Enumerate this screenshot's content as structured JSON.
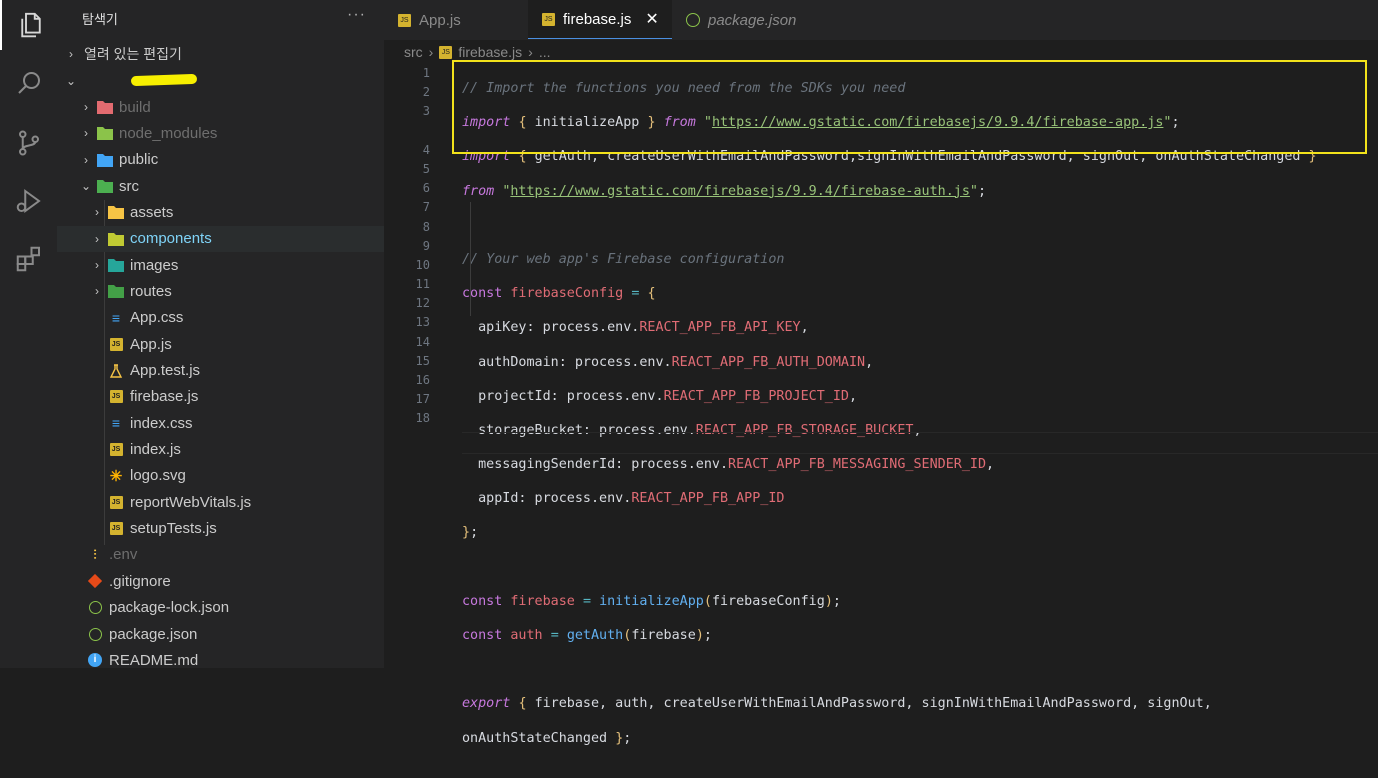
{
  "sidebar": {
    "title": "탐색기",
    "more": "···",
    "open_editors": "열려 있는 편집기",
    "items": [
      {
        "label": "build",
        "kind": "folder",
        "color": "#e36b70",
        "dim": true,
        "chev": "›"
      },
      {
        "label": "node_modules",
        "kind": "folder",
        "color": "#8bc34a",
        "dim": true,
        "chev": "›"
      },
      {
        "label": "public",
        "kind": "folder",
        "color": "#42a5f5",
        "dim": false,
        "chev": "›"
      },
      {
        "label": "src",
        "kind": "folder",
        "color": "#4caf50",
        "dim": false,
        "chev": "⌄"
      },
      {
        "label": "assets",
        "kind": "folder",
        "color": "#f6c445",
        "dim": false,
        "chev": "›"
      },
      {
        "label": "components",
        "kind": "folder",
        "color": "#c0ca33",
        "dim": false,
        "chev": "›"
      },
      {
        "label": "images",
        "kind": "folder",
        "color": "#26a69a",
        "dim": false,
        "chev": "›"
      },
      {
        "label": "routes",
        "kind": "folder",
        "color": "#43a047",
        "dim": false,
        "chev": "›"
      },
      {
        "label": "App.css",
        "kind": "css"
      },
      {
        "label": "App.js",
        "kind": "js"
      },
      {
        "label": "App.test.js",
        "kind": "test"
      },
      {
        "label": "firebase.js",
        "kind": "js"
      },
      {
        "label": "index.css",
        "kind": "css"
      },
      {
        "label": "index.js",
        "kind": "js"
      },
      {
        "label": "logo.svg",
        "kind": "svg"
      },
      {
        "label": "reportWebVitals.js",
        "kind": "js"
      },
      {
        "label": "setupTests.js",
        "kind": "js"
      },
      {
        "label": ".env",
        "kind": "env",
        "dim": true
      },
      {
        "label": ".gitignore",
        "kind": "git"
      },
      {
        "label": "package-lock.json",
        "kind": "node"
      },
      {
        "label": "package.json",
        "kind": "node"
      },
      {
        "label": "README.md",
        "kind": "info"
      }
    ]
  },
  "tabs": [
    {
      "label": "App.js",
      "icon": "JS"
    },
    {
      "label": "firebase.js",
      "icon": "JS",
      "close": "✕"
    },
    {
      "label": "package.json",
      "icon": "node"
    }
  ],
  "breadcrumb": {
    "folder": "src",
    "sep": "›",
    "file": "firebase.js",
    "rest": "..."
  },
  "editor": {
    "line_numbers": [
      "1",
      "2",
      "3",
      "",
      "4",
      "5",
      "6",
      "7",
      "8",
      "9",
      "10",
      "11",
      "12",
      "13",
      "14",
      "15",
      "16",
      "17",
      "18",
      ""
    ]
  }
}
